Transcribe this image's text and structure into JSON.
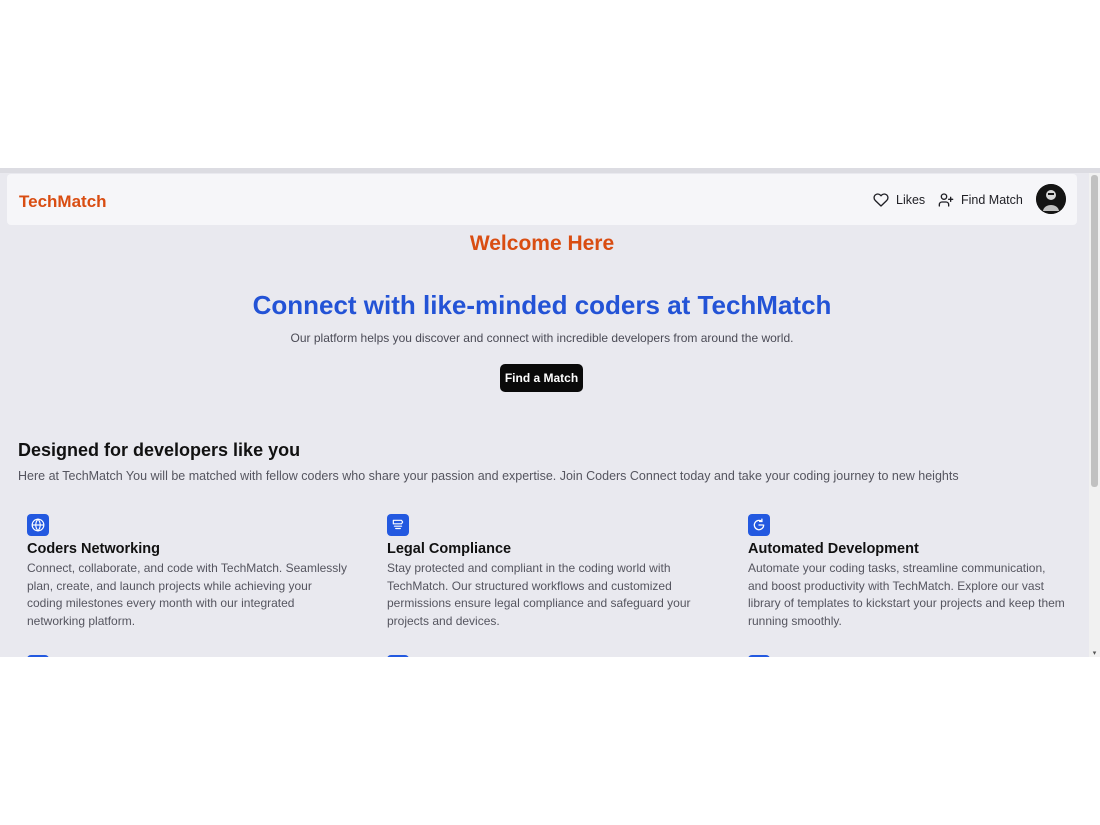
{
  "navbar": {
    "brand": "TechMatch",
    "likes_label": "Likes",
    "find_match_label": "Find Match"
  },
  "hero": {
    "welcome": "Welcome Here",
    "title": "Connect with like-minded coders at TechMatch",
    "subtitle": "Our platform helps you discover and connect with incredible developers from around the world.",
    "cta_label": "Find a Match"
  },
  "section": {
    "title": "Designed for developers like you",
    "subtitle": "Here at TechMatch You will be matched with fellow coders who share your passion and expertise. Join Coders Connect today and take your coding journey to new heights"
  },
  "features": [
    {
      "icon": "globe-icon",
      "title": "Coders Networking",
      "description": "Connect, collaborate, and code with TechMatch. Seamlessly plan, create, and launch projects while achieving your coding milestones every month with our integrated networking platform."
    },
    {
      "icon": "certificate-icon",
      "title": "Legal Compliance",
      "description": "Stay protected and compliant in the coding world with TechMatch. Our structured workflows and customized permissions ensure legal compliance and safeguard your projects and devices."
    },
    {
      "icon": "refresh-icon",
      "title": "Automated Development",
      "description": "Automate your coding tasks, streamline communication, and boost productivity with TechMatch. Explore our vast library of templates to kickstart your projects and keep them running smoothly."
    }
  ],
  "colors": {
    "brand_orange": "#d94d12",
    "hero_blue": "#2353d6",
    "icon_blue": "#2359e0",
    "page_bg": "#e9e9ef"
  }
}
